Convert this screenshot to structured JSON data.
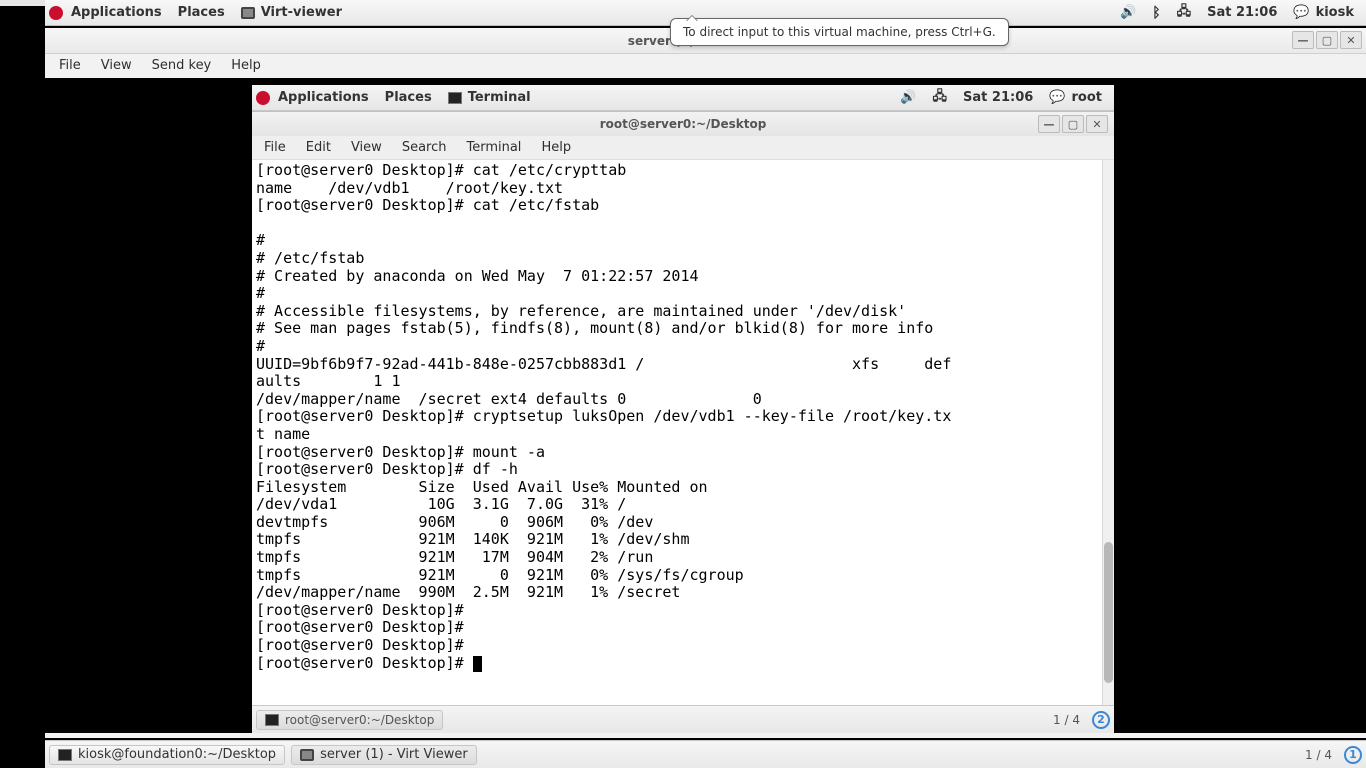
{
  "host": {
    "panel": {
      "applications": "Applications",
      "places": "Places",
      "active_app": "Virt-viewer",
      "clock": "Sat 21:06",
      "user": "kiosk"
    },
    "tooltip": "To direct input to this virtual machine, press Ctrl+G.",
    "bottom": {
      "task1": "kiosk@foundation0:~/Desktop",
      "task2": "server (1) - Virt Viewer",
      "ws": "1 / 4",
      "badge": "1"
    }
  },
  "virt_viewer": {
    "title": "server (1) - Virt Viewer",
    "menus": {
      "file": "File",
      "view": "View",
      "sendkey": "Send key",
      "help": "Help"
    }
  },
  "guest": {
    "panel": {
      "applications": "Applications",
      "places": "Places",
      "active_app": "Terminal",
      "clock": "Sat 21:06",
      "user": "root"
    },
    "bottom": {
      "task1": "root@server0:~/Desktop",
      "ws": "1 / 4",
      "badge": "2"
    }
  },
  "terminal": {
    "title": "root@server0:~/Desktop",
    "menus": {
      "file": "File",
      "edit": "Edit",
      "view": "View",
      "search": "Search",
      "terminal": "Terminal",
      "help": "Help"
    },
    "content": "[root@server0 Desktop]# cat /etc/crypttab\nname    /dev/vdb1    /root/key.txt\n[root@server0 Desktop]# cat /etc/fstab\n\n#\n# /etc/fstab\n# Created by anaconda on Wed May  7 01:22:57 2014\n#\n# Accessible filesystems, by reference, are maintained under '/dev/disk'\n# See man pages fstab(5), findfs(8), mount(8) and/or blkid(8) for more info\n#\nUUID=9bf6b9f7-92ad-441b-848e-0257cbb883d1 /                       xfs     def\naults        1 1\n/dev/mapper/name  /secret ext4 defaults 0              0\n[root@server0 Desktop]# cryptsetup luksOpen /dev/vdb1 --key-file /root/key.tx\nt name\n[root@server0 Desktop]# mount -a\n[root@server0 Desktop]# df -h\nFilesystem        Size  Used Avail Use% Mounted on\n/dev/vda1          10G  3.1G  7.0G  31% /\ndevtmpfs          906M     0  906M   0% /dev\ntmpfs             921M  140K  921M   1% /dev/shm\ntmpfs             921M   17M  904M   2% /run\ntmpfs             921M     0  921M   0% /sys/fs/cgroup\n/dev/mapper/name  990M  2.5M  921M   1% /secret\n[root@server0 Desktop]# \n[root@server0 Desktop]# \n[root@server0 Desktop]# \n[root@server0 Desktop]# "
  }
}
